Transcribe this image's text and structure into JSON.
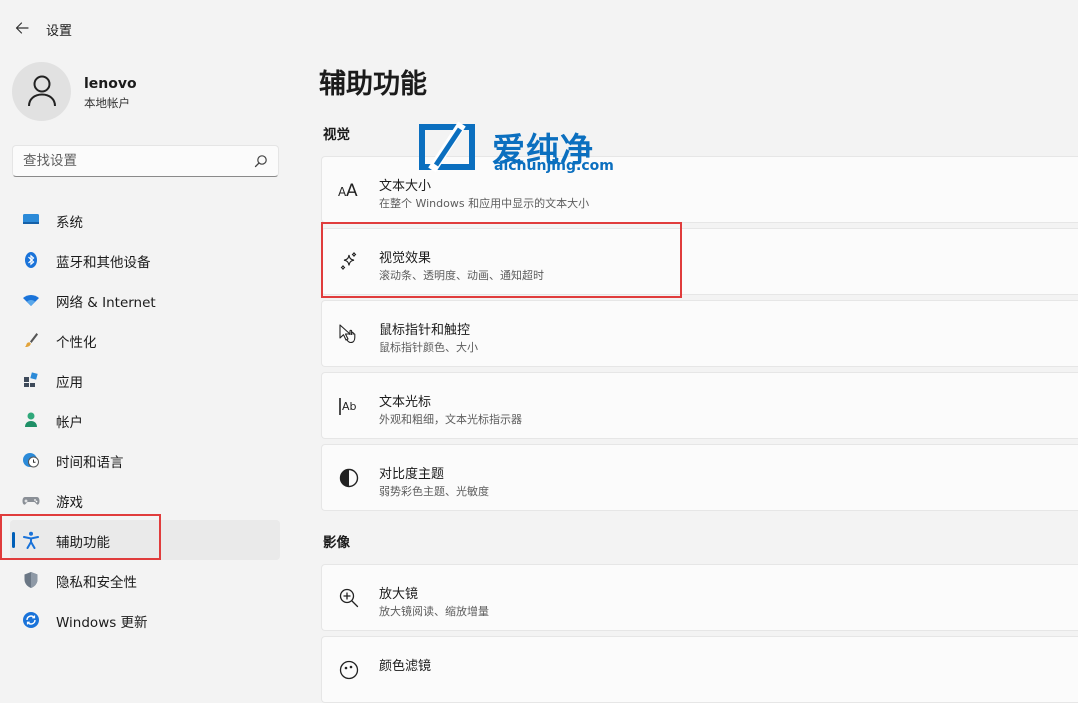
{
  "app": {
    "title": "设置"
  },
  "profile": {
    "name": "lenovo",
    "account_type": "本地帐户"
  },
  "search": {
    "placeholder": "查找设置",
    "value": ""
  },
  "sidebar": {
    "items": [
      {
        "label": "系统",
        "icon": "monitor-icon"
      },
      {
        "label": "蓝牙和其他设备",
        "icon": "bluetooth-icon"
      },
      {
        "label": "网络 & Internet",
        "icon": "wifi-icon"
      },
      {
        "label": "个性化",
        "icon": "brush-icon"
      },
      {
        "label": "应用",
        "icon": "apps-icon"
      },
      {
        "label": "帐户",
        "icon": "person-icon"
      },
      {
        "label": "时间和语言",
        "icon": "globe-clock-icon"
      },
      {
        "label": "游戏",
        "icon": "gamepad-icon"
      },
      {
        "label": "辅助功能",
        "icon": "accessibility-icon",
        "selected": true
      },
      {
        "label": "隐私和安全性",
        "icon": "shield-icon"
      },
      {
        "label": "Windows 更新",
        "icon": "update-icon"
      }
    ]
  },
  "main": {
    "title": "辅助功能",
    "sections": [
      {
        "title": "视觉",
        "cards": [
          {
            "title": "文本大小",
            "desc": "在整个 Windows 和应用中显示的文本大小",
            "icon": "text-size-icon"
          },
          {
            "title": "视觉效果",
            "desc": "滚动条、透明度、动画、通知超时",
            "icon": "sparkle-icon"
          },
          {
            "title": "鼠标指针和触控",
            "desc": "鼠标指针颜色、大小",
            "icon": "pointer-touch-icon"
          },
          {
            "title": "文本光标",
            "desc": "外观和粗细，文本光标指示器",
            "icon": "text-cursor-icon"
          },
          {
            "title": "对比度主题",
            "desc": "弱势彩色主题、光敏度",
            "icon": "contrast-icon"
          }
        ]
      },
      {
        "title": "影像",
        "cards": [
          {
            "title": "放大镜",
            "desc": "放大镜阅读、缩放增量",
            "icon": "magnifier-icon"
          },
          {
            "title": "颜色滤镜",
            "desc": "",
            "icon": "color-filter-icon"
          }
        ]
      }
    ]
  },
  "watermark": {
    "brand": "爱纯净",
    "url": "aichunjing.com"
  },
  "colors": {
    "accent": "#005fb8",
    "highlight": "#e03c3c",
    "background": "#f3f3f3",
    "card": "#fbfbfb",
    "watermark": "#0b6fbf"
  }
}
